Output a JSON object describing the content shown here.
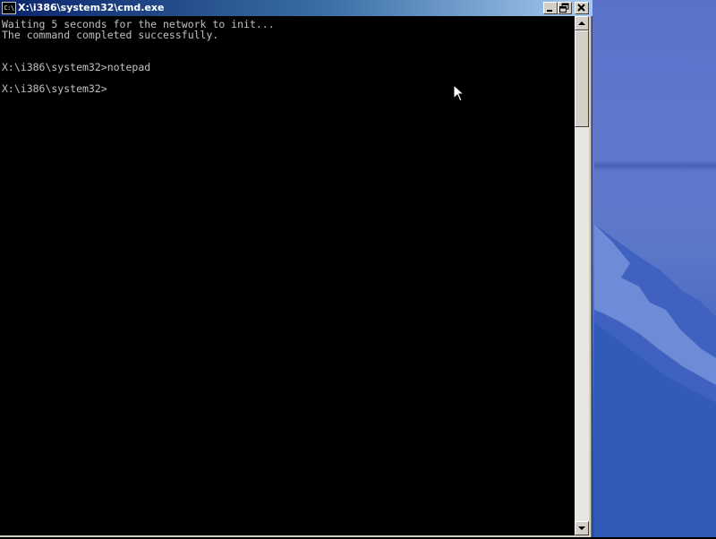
{
  "window": {
    "title": "X:\\i386\\system32\\cmd.exe",
    "icon_text": "C:\\",
    "buttons": {
      "minimize": "minimize-icon",
      "maximize": "restore-icon",
      "close": "close-icon"
    }
  },
  "console": {
    "lines": [
      "Waiting 5 seconds for the network to init...",
      "The command completed successfully.",
      "",
      "X:\\i386\\system32>notepad",
      "",
      "X:\\i386\\system32>"
    ],
    "text_color": "#c0c0c0",
    "background": "#000000"
  },
  "scrollbar": {
    "up_icon": "arrow-up-icon",
    "down_icon": "arrow-down-icon"
  },
  "colors": {
    "titlebar_start": "#0a246a",
    "titlebar_end": "#a6caf0",
    "desktop": "#5a73c9"
  }
}
